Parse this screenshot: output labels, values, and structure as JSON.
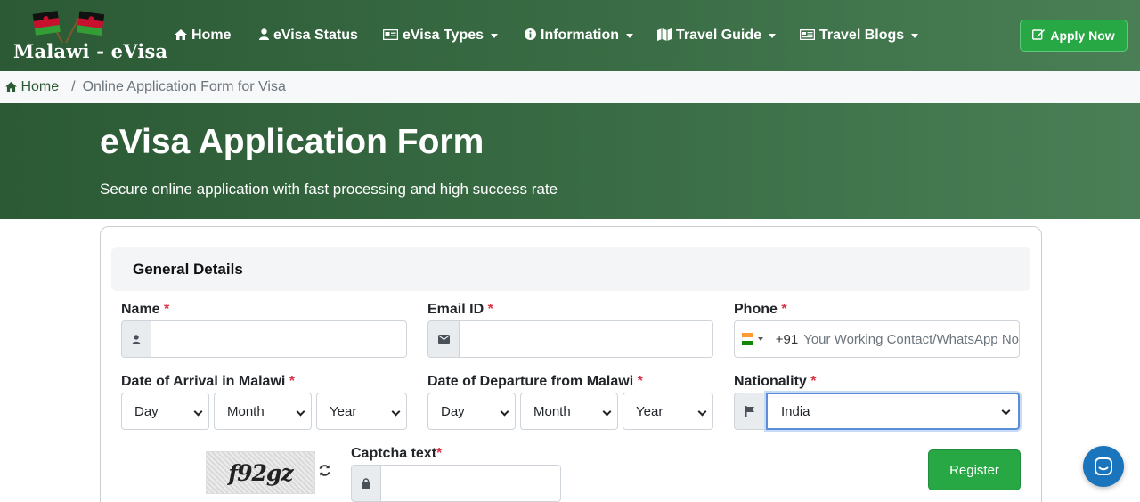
{
  "header": {
    "logo_text": "Malawi - eVisa",
    "nav": [
      {
        "label": "Home",
        "icon": "home-icon"
      },
      {
        "label": "eVisa Status",
        "icon": "user-icon"
      },
      {
        "label": "eVisa Types",
        "icon": "id-card-icon"
      },
      {
        "label": "Information",
        "icon": "info-circle-icon"
      },
      {
        "label": "Travel Guide",
        "icon": "map-icon"
      },
      {
        "label": "Travel Blogs",
        "icon": "newspaper-icon"
      }
    ],
    "apply_label": "Apply Now"
  },
  "breadcrumb": {
    "home": "Home",
    "current": "Online Application Form for Visa"
  },
  "hero": {
    "title": "eVisa Application Form",
    "subtitle": "Secure online application with fast processing and high success rate"
  },
  "form": {
    "section_title": "General Details",
    "name_label": "Name",
    "email_label": "Email ID",
    "phone_label": "Phone",
    "phone_dial": "+91",
    "phone_placeholder": "Your Working Contact/WhatsApp No",
    "arrival_label": "Date of Arrival in Malawi",
    "departure_label": "Date of Departure from Malawi",
    "nationality_label": "Nationality",
    "nationality_value": "India",
    "day": "Day",
    "month": "Month",
    "year": "Year",
    "required_mark": "*",
    "captcha_image_text": "f92gz",
    "captcha_label": "Captcha text",
    "register_label": "Register"
  },
  "colors": {
    "brand_green": "#2b5a35",
    "button_green": "#28a745",
    "required_red": "#dc3545",
    "chat_blue": "#1b75bc"
  }
}
